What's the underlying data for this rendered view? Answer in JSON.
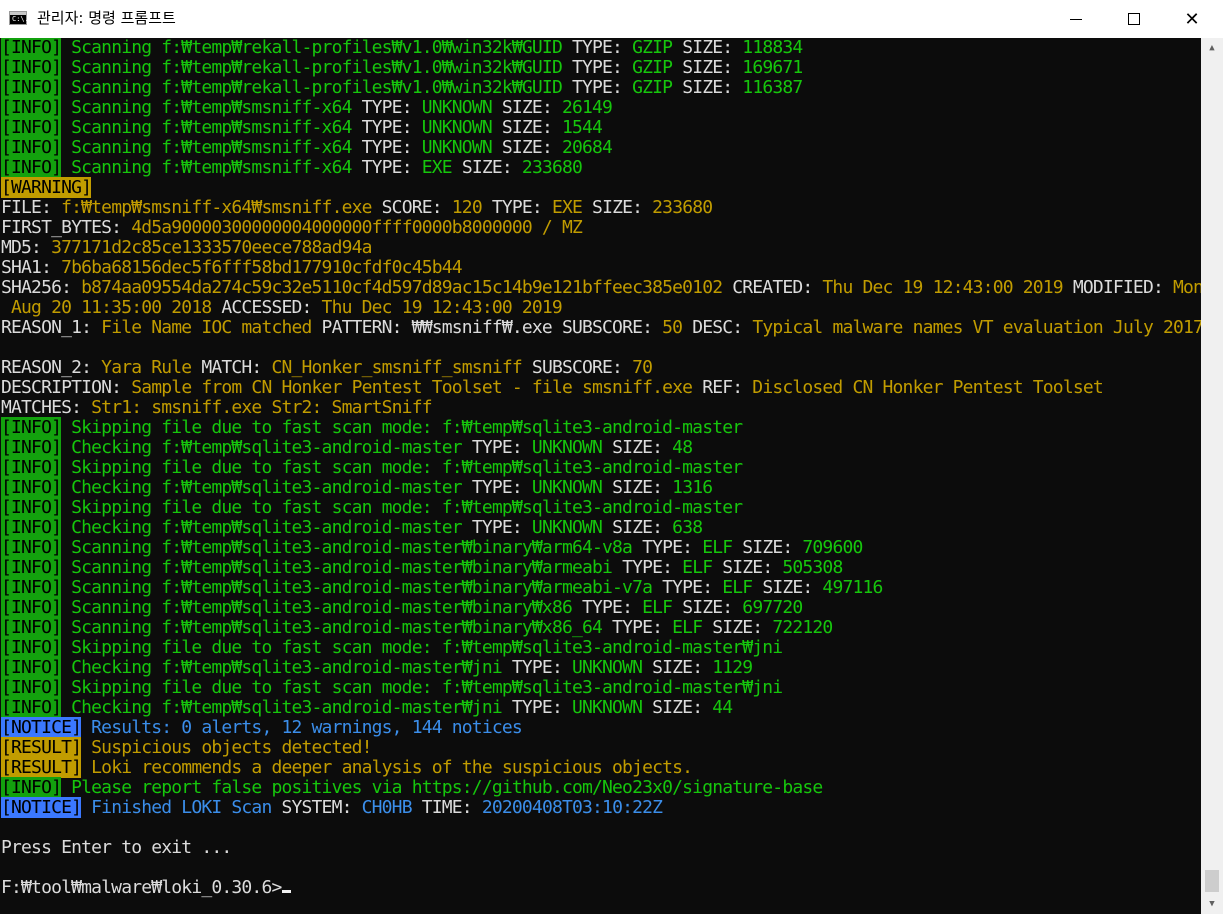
{
  "window": {
    "title": "관리자: 명령 프롬프트",
    "icon_text": "C:\\.",
    "minimize_icon": "minimize-icon",
    "maximize_icon": "maximize-icon",
    "close_label": "✕"
  },
  "colors": {
    "console_bg": "#0c0c0c",
    "white": "#dcdcdc",
    "green": "#16c60c",
    "yellow": "#c19c00",
    "cyan": "#3b8eea",
    "info_tag_bg": "#13a10e",
    "warning_tag_bg": "#c19c00",
    "notice_tag_bg": "#3b78ff"
  },
  "console": {
    "lines": [
      [
        [
          "[INFO]",
          "ti"
        ],
        [
          " Scanning f:₩temp₩rekall-profiles₩v1.0₩win32k₩GUID",
          "g"
        ],
        [
          " TYPE: ",
          "w"
        ],
        [
          "GZIP",
          "g"
        ],
        [
          " SIZE: ",
          "w"
        ],
        [
          "118834",
          "g"
        ]
      ],
      [
        [
          "[INFO]",
          "ti"
        ],
        [
          " Scanning f:₩temp₩rekall-profiles₩v1.0₩win32k₩GUID",
          "g"
        ],
        [
          " TYPE: ",
          "w"
        ],
        [
          "GZIP",
          "g"
        ],
        [
          " SIZE: ",
          "w"
        ],
        [
          "169671",
          "g"
        ]
      ],
      [
        [
          "[INFO]",
          "ti"
        ],
        [
          " Scanning f:₩temp₩rekall-profiles₩v1.0₩win32k₩GUID",
          "g"
        ],
        [
          " TYPE: ",
          "w"
        ],
        [
          "GZIP",
          "g"
        ],
        [
          " SIZE: ",
          "w"
        ],
        [
          "116387",
          "g"
        ]
      ],
      [
        [
          "[INFO]",
          "ti"
        ],
        [
          " Scanning f:₩temp₩smsniff-x64",
          "g"
        ],
        [
          " TYPE: ",
          "w"
        ],
        [
          "UNKNOWN",
          "g"
        ],
        [
          " SIZE: ",
          "w"
        ],
        [
          "26149",
          "g"
        ]
      ],
      [
        [
          "[INFO]",
          "ti"
        ],
        [
          " Scanning f:₩temp₩smsniff-x64",
          "g"
        ],
        [
          " TYPE: ",
          "w"
        ],
        [
          "UNKNOWN",
          "g"
        ],
        [
          " SIZE: ",
          "w"
        ],
        [
          "1544",
          "g"
        ]
      ],
      [
        [
          "[INFO]",
          "ti"
        ],
        [
          " Scanning f:₩temp₩smsniff-x64",
          "g"
        ],
        [
          " TYPE: ",
          "w"
        ],
        [
          "UNKNOWN",
          "g"
        ],
        [
          " SIZE: ",
          "w"
        ],
        [
          "20684",
          "g"
        ]
      ],
      [
        [
          "[INFO]",
          "ti"
        ],
        [
          " Scanning f:₩temp₩smsniff-x64",
          "g"
        ],
        [
          " TYPE: ",
          "w"
        ],
        [
          "EXE",
          "g"
        ],
        [
          " SIZE: ",
          "w"
        ],
        [
          "233680",
          "g"
        ]
      ],
      [
        [
          "[WARNING]",
          "tw"
        ]
      ],
      [
        [
          "FILE: ",
          "w"
        ],
        [
          "f:₩temp₩smsniff-x64₩smsniff.exe",
          "y"
        ],
        [
          " SCORE: ",
          "w"
        ],
        [
          "120",
          "y"
        ],
        [
          " TYPE: ",
          "w"
        ],
        [
          "EXE",
          "y"
        ],
        [
          " SIZE: ",
          "w"
        ],
        [
          "233680",
          "y"
        ]
      ],
      [
        [
          "FIRST_BYTES: ",
          "w"
        ],
        [
          "4d5a90000300000004000000ffff0000b8000000 / MZ",
          "y"
        ]
      ],
      [
        [
          "MD5: ",
          "w"
        ],
        [
          "377171d2c85ce1333570eece788ad94a",
          "y"
        ]
      ],
      [
        [
          "SHA1: ",
          "w"
        ],
        [
          "7b6ba68156dec5f6fff58bd177910cfdf0c45b44",
          "y"
        ]
      ],
      [
        [
          "SHA256: ",
          "w"
        ],
        [
          "b874aa09554da274c59c32e5110cf4d597d89ac15c14b9e121bffeec385e0102",
          "y"
        ],
        [
          " CREATED: ",
          "w"
        ],
        [
          "Thu Dec 19 12:43:00 2019",
          "y"
        ],
        [
          " MODIFIED: ",
          "w"
        ],
        [
          "Mon",
          "y"
        ]
      ],
      [
        [
          " Aug 20 11:35:00 2018",
          "y"
        ],
        [
          " ACCESSED: ",
          "w"
        ],
        [
          "Thu Dec 19 12:43:00 2019",
          "y"
        ]
      ],
      [
        [
          "REASON_1: ",
          "w"
        ],
        [
          "File Name IOC matched",
          "y"
        ],
        [
          " PATTERN: ",
          "w"
        ],
        [
          "₩₩smsniff₩.exe",
          "w"
        ],
        [
          " SUBSCORE: ",
          "w"
        ],
        [
          "50",
          "y"
        ],
        [
          " DESC: ",
          "w"
        ],
        [
          "Typical malware names VT evaluation July 2017",
          "y"
        ]
      ],
      [],
      [
        [
          "REASON_2: ",
          "w"
        ],
        [
          "Yara Rule",
          "y"
        ],
        [
          " MATCH: ",
          "w"
        ],
        [
          "CN_Honker_smsniff_smsniff",
          "y"
        ],
        [
          " SUBSCORE: ",
          "w"
        ],
        [
          "70",
          "y"
        ]
      ],
      [
        [
          "DESCRIPTION: ",
          "w"
        ],
        [
          "Sample from CN Honker Pentest Toolset - file smsniff.exe",
          "y"
        ],
        [
          " REF: ",
          "w"
        ],
        [
          "Disclosed CN Honker Pentest Toolset",
          "y"
        ]
      ],
      [
        [
          "MATCHES: ",
          "w"
        ],
        [
          "Str1: smsniff.exe Str2: SmartSniff",
          "y"
        ]
      ],
      [
        [
          "[INFO]",
          "ti"
        ],
        [
          " Skipping file due to fast scan mode: f:₩temp₩sqlite3-android-master",
          "g"
        ]
      ],
      [
        [
          "[INFO]",
          "ti"
        ],
        [
          " Checking f:₩temp₩sqlite3-android-master",
          "g"
        ],
        [
          " TYPE: ",
          "w"
        ],
        [
          "UNKNOWN",
          "g"
        ],
        [
          " SIZE: ",
          "w"
        ],
        [
          "48",
          "g"
        ]
      ],
      [
        [
          "[INFO]",
          "ti"
        ],
        [
          " Skipping file due to fast scan mode: f:₩temp₩sqlite3-android-master",
          "g"
        ]
      ],
      [
        [
          "[INFO]",
          "ti"
        ],
        [
          " Checking f:₩temp₩sqlite3-android-master",
          "g"
        ],
        [
          " TYPE: ",
          "w"
        ],
        [
          "UNKNOWN",
          "g"
        ],
        [
          " SIZE: ",
          "w"
        ],
        [
          "1316",
          "g"
        ]
      ],
      [
        [
          "[INFO]",
          "ti"
        ],
        [
          " Skipping file due to fast scan mode: f:₩temp₩sqlite3-android-master",
          "g"
        ]
      ],
      [
        [
          "[INFO]",
          "ti"
        ],
        [
          " Checking f:₩temp₩sqlite3-android-master",
          "g"
        ],
        [
          " TYPE: ",
          "w"
        ],
        [
          "UNKNOWN",
          "g"
        ],
        [
          " SIZE: ",
          "w"
        ],
        [
          "638",
          "g"
        ]
      ],
      [
        [
          "[INFO]",
          "ti"
        ],
        [
          " Scanning f:₩temp₩sqlite3-android-master₩binary₩arm64-v8a",
          "g"
        ],
        [
          " TYPE: ",
          "w"
        ],
        [
          "ELF",
          "g"
        ],
        [
          " SIZE: ",
          "w"
        ],
        [
          "709600",
          "g"
        ]
      ],
      [
        [
          "[INFO]",
          "ti"
        ],
        [
          " Scanning f:₩temp₩sqlite3-android-master₩binary₩armeabi",
          "g"
        ],
        [
          " TYPE: ",
          "w"
        ],
        [
          "ELF",
          "g"
        ],
        [
          " SIZE: ",
          "w"
        ],
        [
          "505308",
          "g"
        ]
      ],
      [
        [
          "[INFO]",
          "ti"
        ],
        [
          " Scanning f:₩temp₩sqlite3-android-master₩binary₩armeabi-v7a",
          "g"
        ],
        [
          " TYPE: ",
          "w"
        ],
        [
          "ELF",
          "g"
        ],
        [
          " SIZE: ",
          "w"
        ],
        [
          "497116",
          "g"
        ]
      ],
      [
        [
          "[INFO]",
          "ti"
        ],
        [
          " Scanning f:₩temp₩sqlite3-android-master₩binary₩x86",
          "g"
        ],
        [
          " TYPE: ",
          "w"
        ],
        [
          "ELF",
          "g"
        ],
        [
          " SIZE: ",
          "w"
        ],
        [
          "697720",
          "g"
        ]
      ],
      [
        [
          "[INFO]",
          "ti"
        ],
        [
          " Scanning f:₩temp₩sqlite3-android-master₩binary₩x86_64",
          "g"
        ],
        [
          " TYPE: ",
          "w"
        ],
        [
          "ELF",
          "g"
        ],
        [
          " SIZE: ",
          "w"
        ],
        [
          "722120",
          "g"
        ]
      ],
      [
        [
          "[INFO]",
          "ti"
        ],
        [
          " Skipping file due to fast scan mode: f:₩temp₩sqlite3-android-master₩jni",
          "g"
        ]
      ],
      [
        [
          "[INFO]",
          "ti"
        ],
        [
          " Checking f:₩temp₩sqlite3-android-master₩jni",
          "g"
        ],
        [
          " TYPE: ",
          "w"
        ],
        [
          "UNKNOWN",
          "g"
        ],
        [
          " SIZE: ",
          "w"
        ],
        [
          "1129",
          "g"
        ]
      ],
      [
        [
          "[INFO]",
          "ti"
        ],
        [
          " Skipping file due to fast scan mode: f:₩temp₩sqlite3-android-master₩jni",
          "g"
        ]
      ],
      [
        [
          "[INFO]",
          "ti"
        ],
        [
          " Checking f:₩temp₩sqlite3-android-master₩jni",
          "g"
        ],
        [
          " TYPE: ",
          "w"
        ],
        [
          "UNKNOWN",
          "g"
        ],
        [
          " SIZE: ",
          "w"
        ],
        [
          "44",
          "g"
        ]
      ],
      [
        [
          "[NOTICE]",
          "tn"
        ],
        [
          " Results: 0 alerts, 12 warnings, 144 notices",
          "c"
        ]
      ],
      [
        [
          "[RESULT]",
          "tr"
        ],
        [
          " Suspicious objects detected!",
          "y"
        ]
      ],
      [
        [
          "[RESULT]",
          "tr"
        ],
        [
          " Loki recommends a deeper analysis of the suspicious objects.",
          "y"
        ]
      ],
      [
        [
          "[INFO]",
          "ti"
        ],
        [
          " Please report false positives via https://github.com/Neo23x0/signature-base",
          "g"
        ]
      ],
      [
        [
          "[NOTICE]",
          "tn"
        ],
        [
          " Finished LOKI Scan",
          "c"
        ],
        [
          " SYSTEM: ",
          "w"
        ],
        [
          "CH0HB",
          "c"
        ],
        [
          " TIME: ",
          "w"
        ],
        [
          "20200408T03:10:22Z",
          "c"
        ]
      ],
      [],
      [
        [
          "Press Enter to exit ...",
          "w"
        ]
      ],
      [],
      [
        [
          "F:₩tool₩malware₩loki_0.30.6>",
          "w"
        ]
      ]
    ]
  },
  "scrollbar": {
    "up_arrow": "▲",
    "down_arrow": "▼",
    "position_fraction": 1.0
  }
}
